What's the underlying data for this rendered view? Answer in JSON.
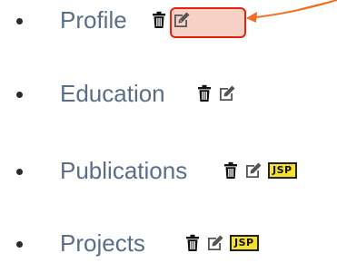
{
  "items": [
    {
      "label": "Profile",
      "badge": ""
    },
    {
      "label": "Education",
      "badge": ""
    },
    {
      "label": "Publications",
      "badge": "JSP"
    },
    {
      "label": "Projects",
      "badge": "JSP"
    }
  ],
  "icons": {
    "delete": "trash-icon",
    "edit": "edit-icon"
  },
  "colors": {
    "label": "#5a6e8a",
    "highlight_fill": "#f6d2c6",
    "highlight_border": "#e8200c",
    "arrow": "#f07020",
    "badge_bg": "#f5e12a"
  }
}
